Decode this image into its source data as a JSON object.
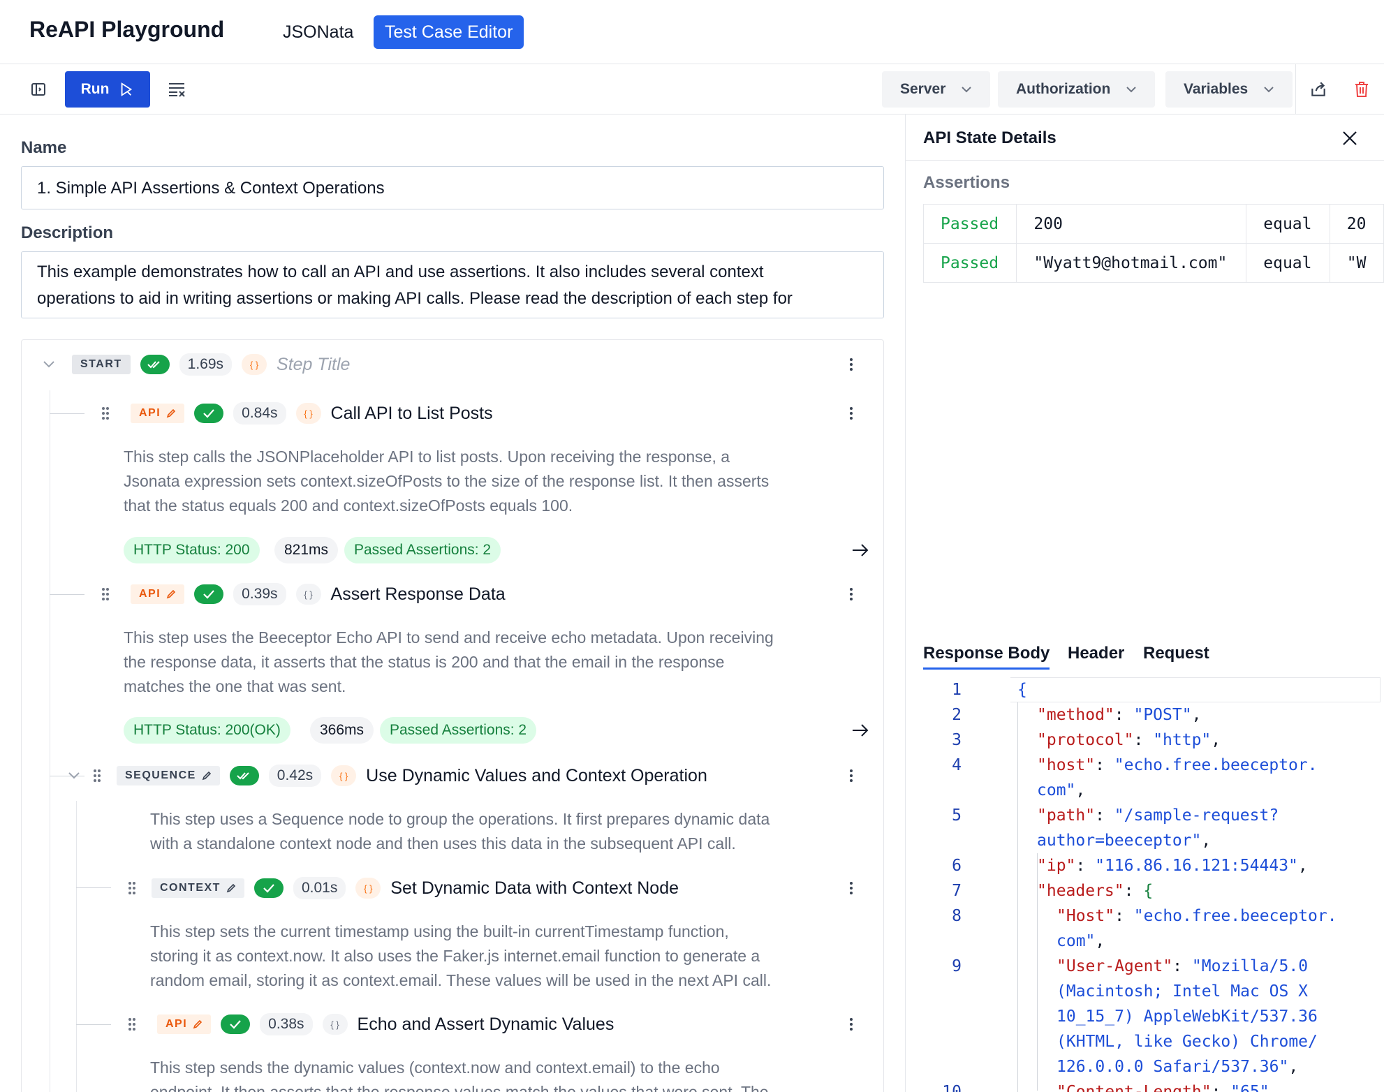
{
  "app": {
    "title": "ReAPI Playground"
  },
  "nav": {
    "tab_jsonata": "JSONata",
    "tab_editor": "Test Case Editor"
  },
  "toolbar": {
    "run": "Run",
    "server": "Server",
    "authorization": "Authorization",
    "variables": "Variables"
  },
  "form": {
    "name_label": "Name",
    "name_value": "1. Simple API Assertions & Context Operations",
    "description_label": "Description",
    "description_line1": "This example demonstrates how to call an API and use assertions. It also includes several context",
    "description_line2": "operations to aid in writing assertions or making API calls. Please read the description of each step for"
  },
  "steps": {
    "start": {
      "type": "START",
      "time": "1.69s",
      "title": "Step Title"
    },
    "s1": {
      "type": "API",
      "time": "0.84s",
      "title": "Call API to List Posts",
      "desc1": "This step calls the JSONPlaceholder API to list posts. Upon receiving the response, a",
      "desc2": "Jsonata expression sets context.sizeOfPosts to the size of the response list. It then asserts",
      "desc3": "that the status equals 200 and context.sizeOfPosts equals 100.",
      "chip_status": "HTTP Status: 200",
      "chip_time": "821ms",
      "chip_assert": "Passed Assertions: 2"
    },
    "s2": {
      "type": "API",
      "time": "0.39s",
      "title": "Assert Response Data",
      "desc1": "This step uses the Beeceptor Echo API to send and receive echo metadata. Upon receiving",
      "desc2": "the response data, it asserts that the status is 200 and that the email in the response",
      "desc3": "matches the one that was sent.",
      "chip_status": "HTTP Status: 200(OK)",
      "chip_time": "366ms",
      "chip_assert": "Passed Assertions: 2"
    },
    "s3": {
      "type": "SEQUENCE",
      "time": "0.42s",
      "title": "Use Dynamic Values and Context Operation",
      "desc1": "This step uses a Sequence node to group the operations. It first prepares dynamic data",
      "desc2": "with a standalone context node and then uses this data in the subsequent API call."
    },
    "s4": {
      "type": "CONTEXT",
      "time": "0.01s",
      "title": "Set Dynamic Data with Context Node",
      "desc1": "This step sets the current timestamp using the built-in currentTimestamp function,",
      "desc2": "storing it as context.now. It also uses the Faker.js internet.email function to generate a",
      "desc3": "random email, storing it as context.email. These values will be used in the next API call."
    },
    "s5": {
      "type": "API",
      "time": "0.38s",
      "title": "Echo and Assert Dynamic Values",
      "desc1": "This step sends the dynamic values (context.now and context.email) to the echo",
      "desc2": "endpoint. It then asserts that the response values match the values that were sent. The"
    }
  },
  "panel": {
    "title": "API State Details",
    "assertions_label": "Assertions",
    "rows": [
      {
        "status": "Passed",
        "actual": "200",
        "op": "equal",
        "expected": "20"
      },
      {
        "status": "Passed",
        "actual": "\"Wyatt9@hotmail.com\"",
        "op": "equal",
        "expected": "\"W"
      }
    ],
    "tab_body": "Response Body",
    "tab_header": "Header",
    "tab_request": "Request"
  },
  "code": {
    "n": [
      "1",
      "2",
      "3",
      "4",
      "5",
      "6",
      "7",
      "8",
      "9",
      "10"
    ],
    "l1": "{",
    "l2k": "\"method\"",
    "l2v": "\"POST\"",
    "l3k": "\"protocol\"",
    "l3v": "\"http\"",
    "l4k": "\"host\"",
    "l4v": "\"echo.free.beeceptor.",
    "l4v2": "com\"",
    "l5k": "\"path\"",
    "l5v": "\"/sample-request?",
    "l5v2": "author=beeceptor\"",
    "l6k": "\"ip\"",
    "l6v": "\"116.86.16.121:54443\"",
    "l7k": "\"headers\"",
    "l7v": "{",
    "l8k": "\"Host\"",
    "l8v": "\"echo.free.beeceptor.",
    "l8v2": "com\"",
    "l9k": "\"User-Agent\"",
    "l9v": "\"Mozilla/5.0",
    "l9v2": "(Macintosh; Intel Mac OS X",
    "l9v3": "10_15_7) AppleWebKit/537.36",
    "l9v4": "(KHTML, like Gecko) Chrome/",
    "l9v5": "126.0.0.0 Safari/537.36\"",
    "l10k": "\"Content-Length\"",
    "l10v": "\"65\""
  }
}
